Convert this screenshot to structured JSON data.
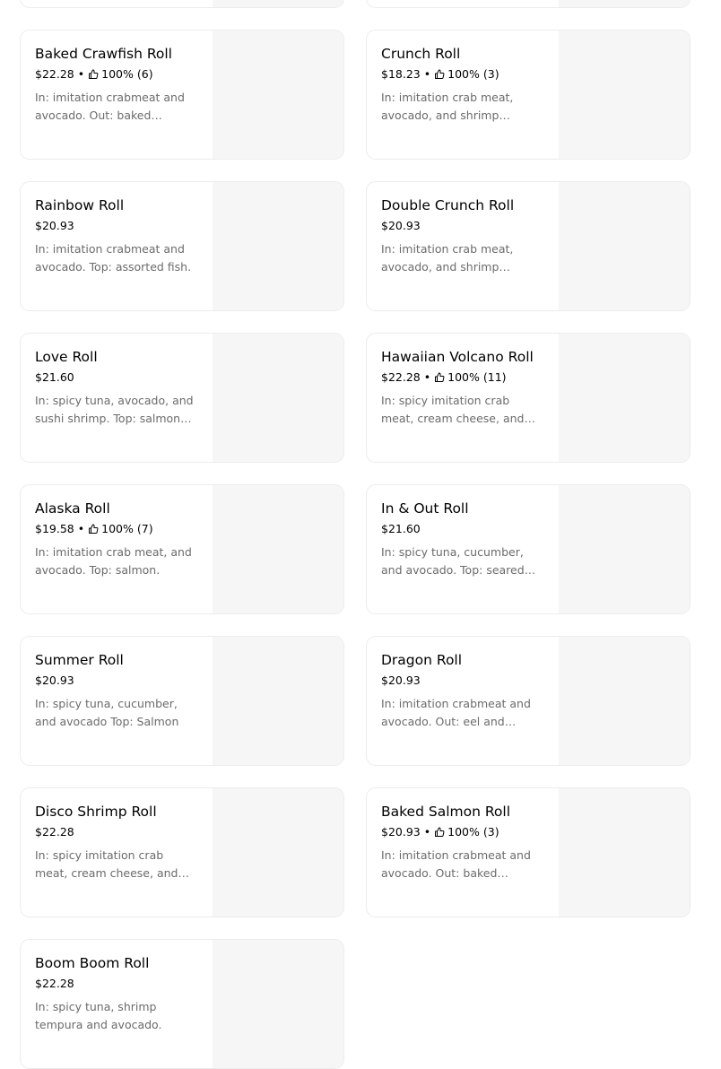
{
  "menu": {
    "items": [
      {
        "name": "",
        "price": "",
        "rating": "",
        "count": "",
        "description": ""
      },
      {
        "name": "",
        "price": "",
        "rating": "",
        "count": "",
        "description": ""
      },
      {
        "name": "Baked Crawfish Roll",
        "price": "$22.28",
        "rating": "100%",
        "count": "(6)",
        "description": "In: imitation crabmeat and avocado. Out: baked crawfish."
      },
      {
        "name": "Crunch Roll",
        "price": "$18.23",
        "rating": "100%",
        "count": "(3)",
        "description": "In: imitation crab meat, avocado, and shrimp tempura."
      },
      {
        "name": "Rainbow Roll",
        "price": "$20.93",
        "rating": "",
        "count": "",
        "description": "In: imitation crabmeat and avocado. Top: assorted fish."
      },
      {
        "name": "Double Crunch Roll",
        "price": "$20.93",
        "rating": "",
        "count": "",
        "description": "In: imitation crab meat, avocado, and shrimp tempura."
      },
      {
        "name": "Love Roll",
        "price": "$21.60",
        "rating": "",
        "count": "",
        "description": "In: spicy tuna, avocado, and sushi shrimp. Top: salmon and tuna."
      },
      {
        "name": "Hawaiian Volcano Roll",
        "price": "$22.28",
        "rating": "100%",
        "count": "(11)",
        "description": "In: spicy imitation crab meat, cream cheese, and avocado."
      },
      {
        "name": "Alaska Roll",
        "price": "$19.58",
        "rating": "100%",
        "count": "(7)",
        "description": "In: imitation crab meat, and avocado. Top: salmon."
      },
      {
        "name": "In & Out Roll",
        "price": "$21.60",
        "rating": "",
        "count": "",
        "description": "In: spicy tuna, cucumber, and avocado. Top: seared salmon."
      },
      {
        "name": "Summer Roll",
        "price": "$20.93",
        "rating": "",
        "count": "",
        "description": "In: spicy tuna, cucumber, and avocado Top: Salmon"
      },
      {
        "name": "Dragon Roll",
        "price": "$20.93",
        "rating": "",
        "count": "",
        "description": "In: imitation crabmeat and avocado. Out: eel and avocado."
      },
      {
        "name": "Disco Shrimp Roll",
        "price": "$22.28",
        "rating": "",
        "count": "",
        "description": "In: spicy imitation crab meat, cream cheese, and avocado."
      },
      {
        "name": "Baked Salmon Roll",
        "price": "$20.93",
        "rating": "100%",
        "count": "(3)",
        "description": "In: imitation crabmeat and avocado. Out: baked salmon."
      },
      {
        "name": "Boom Boom Roll",
        "price": "$22.28",
        "rating": "",
        "count": "",
        "description": "In: spicy tuna, shrimp tempura and avocado."
      }
    ]
  },
  "icons": {
    "rating": "thumbs-up-icon"
  },
  "colors": {
    "title": "#000000",
    "description": "#6b6b6b",
    "image_placeholder": "#f6f6f6",
    "card_border": "#ececec"
  }
}
